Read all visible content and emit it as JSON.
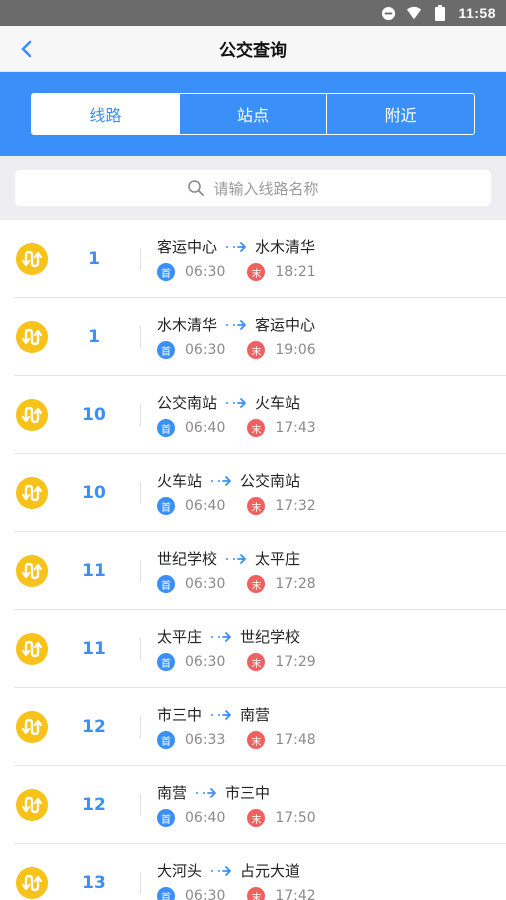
{
  "status_bar": {
    "time": "11:58"
  },
  "header": {
    "title": "公交查询"
  },
  "tabs": [
    {
      "label": "线路",
      "active": true
    },
    {
      "label": "站点",
      "active": false
    },
    {
      "label": "附近",
      "active": false
    }
  ],
  "search": {
    "placeholder": "请输入线路名称"
  },
  "badges": {
    "first": "首",
    "last": "末"
  },
  "colors": {
    "accent": "#3a90f8",
    "bus_icon": "#f7c21a",
    "last_badge": "#f16060"
  },
  "routes": [
    {
      "line": "1",
      "from": "客运中心",
      "to": "水木清华",
      "first": "06:30",
      "last": "18:21"
    },
    {
      "line": "1",
      "from": "水木清华",
      "to": "客运中心",
      "first": "06:30",
      "last": "19:06"
    },
    {
      "line": "10",
      "from": "公交南站",
      "to": "火车站",
      "first": "06:40",
      "last": "17:43"
    },
    {
      "line": "10",
      "from": "火车站",
      "to": "公交南站",
      "first": "06:40",
      "last": "17:32"
    },
    {
      "line": "11",
      "from": "世纪学校",
      "to": "太平庄",
      "first": "06:30",
      "last": "17:28"
    },
    {
      "line": "11",
      "from": "太平庄",
      "to": "世纪学校",
      "first": "06:30",
      "last": "17:29"
    },
    {
      "line": "12",
      "from": "市三中",
      "to": "南营",
      "first": "06:33",
      "last": "17:48"
    },
    {
      "line": "12",
      "from": "南营",
      "to": "市三中",
      "first": "06:40",
      "last": "17:50"
    },
    {
      "line": "13",
      "from": "大河头",
      "to": "占元大道",
      "first": "06:30",
      "last": "17:42"
    }
  ]
}
